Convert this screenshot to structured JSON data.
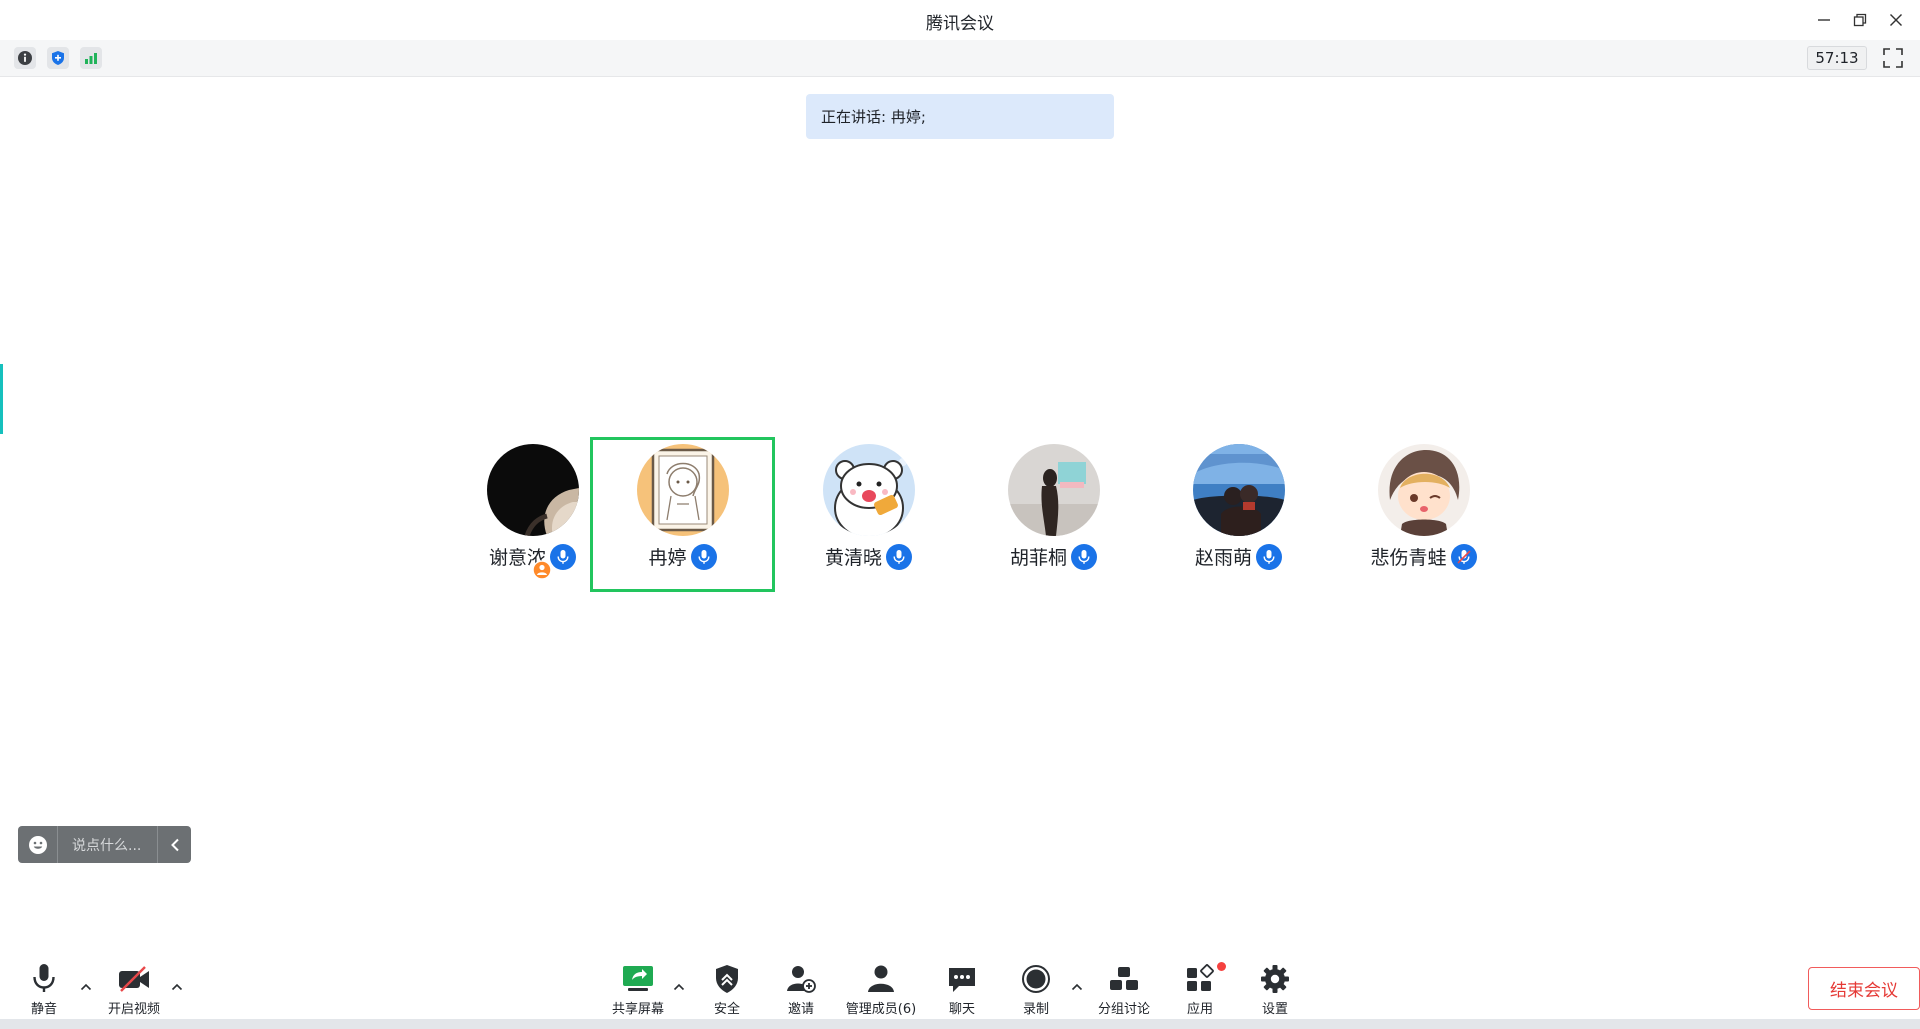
{
  "window": {
    "title": "腾讯会议"
  },
  "infobar": {
    "timer": "57:13"
  },
  "speaking": {
    "text": "正在讲话: 冉婷;"
  },
  "participants": [
    {
      "name": "谢意浓",
      "avatar": "avatar-dark-photo",
      "host": true
    },
    {
      "name": "冉婷",
      "avatar": "avatar-sketch-girl",
      "active": true
    },
    {
      "name": "黄清晓",
      "avatar": "avatar-polar-bear"
    },
    {
      "name": "胡菲桐",
      "avatar": "avatar-girl-gallery"
    },
    {
      "name": "赵雨萌",
      "avatar": "avatar-car-selfie"
    },
    {
      "name": "悲伤青蛙",
      "avatar": "avatar-anime-girl"
    }
  ],
  "chat": {
    "placeholder": "说点什么..."
  },
  "toolbar": {
    "mute": "静音",
    "video": "开启视频",
    "share": "共享屏幕",
    "security": "安全",
    "invite": "邀请",
    "members": "管理成员(6)",
    "chat": "聊天",
    "record": "录制",
    "breakout": "分组讨论",
    "apps": "应用",
    "settings": "设置",
    "end_meeting": "结束会议"
  },
  "colors": {
    "accent_blue": "#1a73e8",
    "active_speaker_border": "#22c55e",
    "end_meeting_red": "#e53935",
    "speaking_banner_bg": "#dce9fb"
  }
}
